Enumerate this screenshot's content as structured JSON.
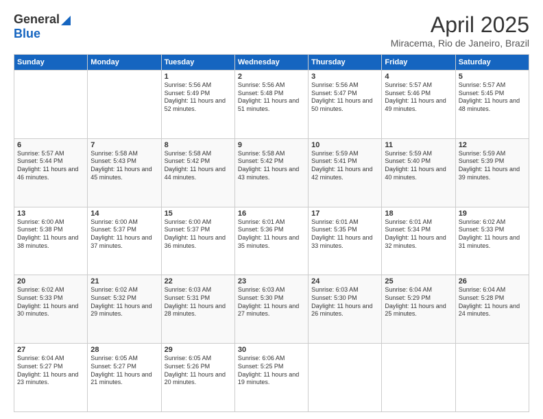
{
  "logo": {
    "general": "General",
    "blue": "Blue"
  },
  "title": "April 2025",
  "location": "Miracema, Rio de Janeiro, Brazil",
  "days_of_week": [
    "Sunday",
    "Monday",
    "Tuesday",
    "Wednesday",
    "Thursday",
    "Friday",
    "Saturday"
  ],
  "weeks": [
    [
      {
        "day": "",
        "sunrise": "",
        "sunset": "",
        "daylight": ""
      },
      {
        "day": "",
        "sunrise": "",
        "sunset": "",
        "daylight": ""
      },
      {
        "day": "1",
        "sunrise": "Sunrise: 5:56 AM",
        "sunset": "Sunset: 5:49 PM",
        "daylight": "Daylight: 11 hours and 52 minutes."
      },
      {
        "day": "2",
        "sunrise": "Sunrise: 5:56 AM",
        "sunset": "Sunset: 5:48 PM",
        "daylight": "Daylight: 11 hours and 51 minutes."
      },
      {
        "day": "3",
        "sunrise": "Sunrise: 5:56 AM",
        "sunset": "Sunset: 5:47 PM",
        "daylight": "Daylight: 11 hours and 50 minutes."
      },
      {
        "day": "4",
        "sunrise": "Sunrise: 5:57 AM",
        "sunset": "Sunset: 5:46 PM",
        "daylight": "Daylight: 11 hours and 49 minutes."
      },
      {
        "day": "5",
        "sunrise": "Sunrise: 5:57 AM",
        "sunset": "Sunset: 5:45 PM",
        "daylight": "Daylight: 11 hours and 48 minutes."
      }
    ],
    [
      {
        "day": "6",
        "sunrise": "Sunrise: 5:57 AM",
        "sunset": "Sunset: 5:44 PM",
        "daylight": "Daylight: 11 hours and 46 minutes."
      },
      {
        "day": "7",
        "sunrise": "Sunrise: 5:58 AM",
        "sunset": "Sunset: 5:43 PM",
        "daylight": "Daylight: 11 hours and 45 minutes."
      },
      {
        "day": "8",
        "sunrise": "Sunrise: 5:58 AM",
        "sunset": "Sunset: 5:42 PM",
        "daylight": "Daylight: 11 hours and 44 minutes."
      },
      {
        "day": "9",
        "sunrise": "Sunrise: 5:58 AM",
        "sunset": "Sunset: 5:42 PM",
        "daylight": "Daylight: 11 hours and 43 minutes."
      },
      {
        "day": "10",
        "sunrise": "Sunrise: 5:59 AM",
        "sunset": "Sunset: 5:41 PM",
        "daylight": "Daylight: 11 hours and 42 minutes."
      },
      {
        "day": "11",
        "sunrise": "Sunrise: 5:59 AM",
        "sunset": "Sunset: 5:40 PM",
        "daylight": "Daylight: 11 hours and 40 minutes."
      },
      {
        "day": "12",
        "sunrise": "Sunrise: 5:59 AM",
        "sunset": "Sunset: 5:39 PM",
        "daylight": "Daylight: 11 hours and 39 minutes."
      }
    ],
    [
      {
        "day": "13",
        "sunrise": "Sunrise: 6:00 AM",
        "sunset": "Sunset: 5:38 PM",
        "daylight": "Daylight: 11 hours and 38 minutes."
      },
      {
        "day": "14",
        "sunrise": "Sunrise: 6:00 AM",
        "sunset": "Sunset: 5:37 PM",
        "daylight": "Daylight: 11 hours and 37 minutes."
      },
      {
        "day": "15",
        "sunrise": "Sunrise: 6:00 AM",
        "sunset": "Sunset: 5:37 PM",
        "daylight": "Daylight: 11 hours and 36 minutes."
      },
      {
        "day": "16",
        "sunrise": "Sunrise: 6:01 AM",
        "sunset": "Sunset: 5:36 PM",
        "daylight": "Daylight: 11 hours and 35 minutes."
      },
      {
        "day": "17",
        "sunrise": "Sunrise: 6:01 AM",
        "sunset": "Sunset: 5:35 PM",
        "daylight": "Daylight: 11 hours and 33 minutes."
      },
      {
        "day": "18",
        "sunrise": "Sunrise: 6:01 AM",
        "sunset": "Sunset: 5:34 PM",
        "daylight": "Daylight: 11 hours and 32 minutes."
      },
      {
        "day": "19",
        "sunrise": "Sunrise: 6:02 AM",
        "sunset": "Sunset: 5:33 PM",
        "daylight": "Daylight: 11 hours and 31 minutes."
      }
    ],
    [
      {
        "day": "20",
        "sunrise": "Sunrise: 6:02 AM",
        "sunset": "Sunset: 5:33 PM",
        "daylight": "Daylight: 11 hours and 30 minutes."
      },
      {
        "day": "21",
        "sunrise": "Sunrise: 6:02 AM",
        "sunset": "Sunset: 5:32 PM",
        "daylight": "Daylight: 11 hours and 29 minutes."
      },
      {
        "day": "22",
        "sunrise": "Sunrise: 6:03 AM",
        "sunset": "Sunset: 5:31 PM",
        "daylight": "Daylight: 11 hours and 28 minutes."
      },
      {
        "day": "23",
        "sunrise": "Sunrise: 6:03 AM",
        "sunset": "Sunset: 5:30 PM",
        "daylight": "Daylight: 11 hours and 27 minutes."
      },
      {
        "day": "24",
        "sunrise": "Sunrise: 6:03 AM",
        "sunset": "Sunset: 5:30 PM",
        "daylight": "Daylight: 11 hours and 26 minutes."
      },
      {
        "day": "25",
        "sunrise": "Sunrise: 6:04 AM",
        "sunset": "Sunset: 5:29 PM",
        "daylight": "Daylight: 11 hours and 25 minutes."
      },
      {
        "day": "26",
        "sunrise": "Sunrise: 6:04 AM",
        "sunset": "Sunset: 5:28 PM",
        "daylight": "Daylight: 11 hours and 24 minutes."
      }
    ],
    [
      {
        "day": "27",
        "sunrise": "Sunrise: 6:04 AM",
        "sunset": "Sunset: 5:27 PM",
        "daylight": "Daylight: 11 hours and 23 minutes."
      },
      {
        "day": "28",
        "sunrise": "Sunrise: 6:05 AM",
        "sunset": "Sunset: 5:27 PM",
        "daylight": "Daylight: 11 hours and 21 minutes."
      },
      {
        "day": "29",
        "sunrise": "Sunrise: 6:05 AM",
        "sunset": "Sunset: 5:26 PM",
        "daylight": "Daylight: 11 hours and 20 minutes."
      },
      {
        "day": "30",
        "sunrise": "Sunrise: 6:06 AM",
        "sunset": "Sunset: 5:25 PM",
        "daylight": "Daylight: 11 hours and 19 minutes."
      },
      {
        "day": "",
        "sunrise": "",
        "sunset": "",
        "daylight": ""
      },
      {
        "day": "",
        "sunrise": "",
        "sunset": "",
        "daylight": ""
      },
      {
        "day": "",
        "sunrise": "",
        "sunset": "",
        "daylight": ""
      }
    ]
  ]
}
